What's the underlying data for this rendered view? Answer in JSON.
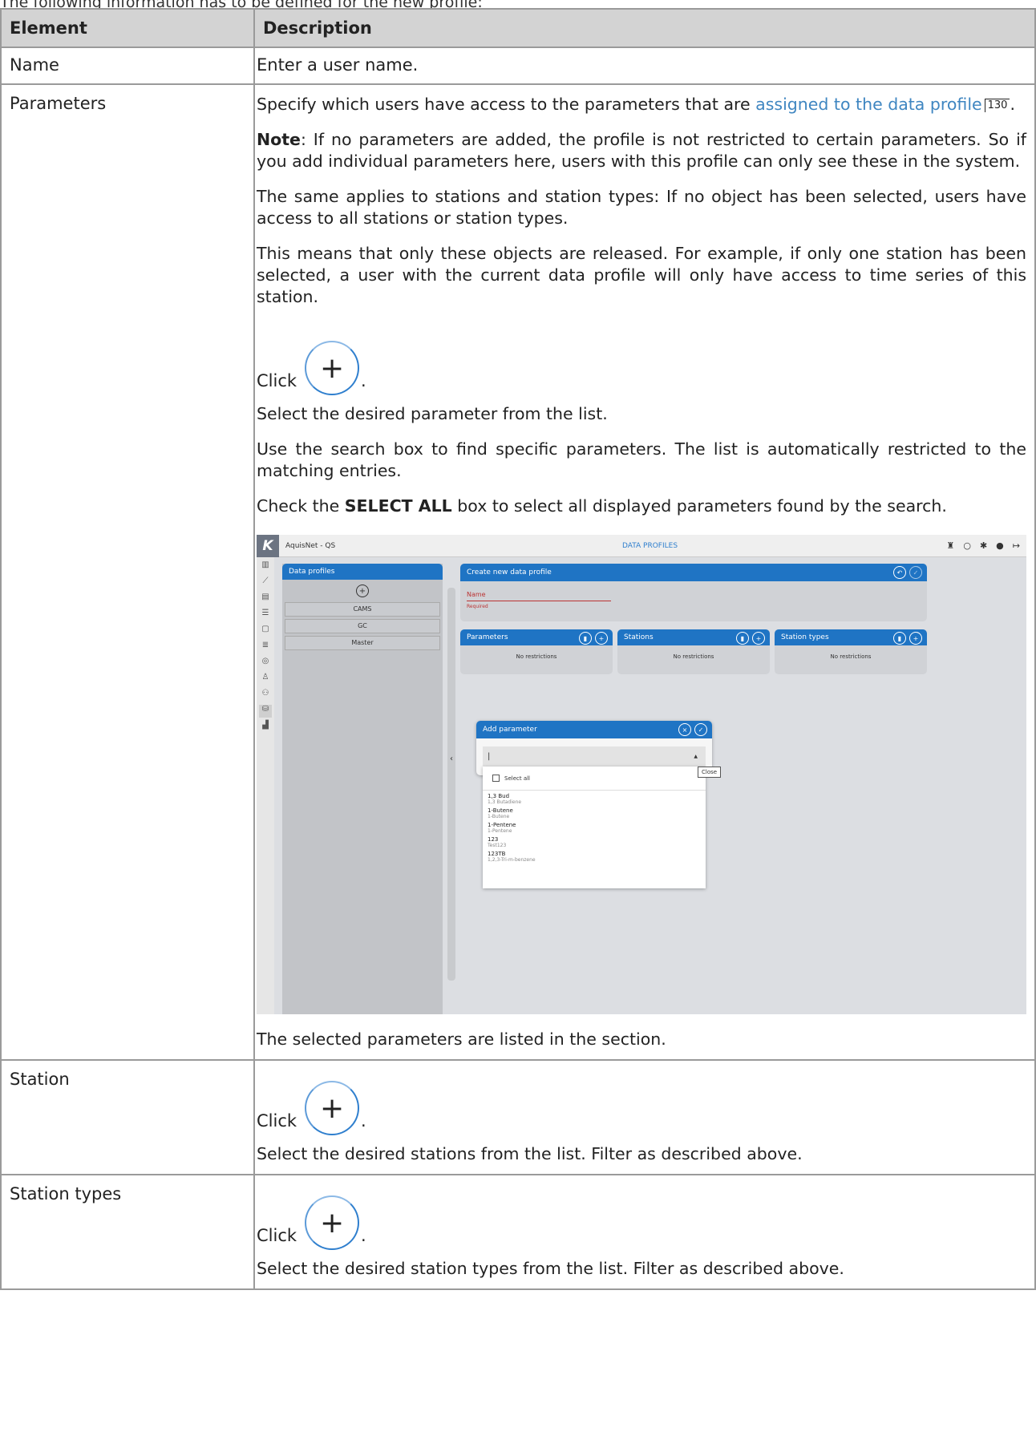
{
  "intro": "The following information has to be defined for the new profile:",
  "table": {
    "headers": [
      "Element",
      "Description"
    ],
    "name_row": {
      "element": "Name",
      "description": "Enter a user name."
    },
    "parameters_row": {
      "element": "Parameters",
      "p1_text": "Specify which users have access to the parameters that are ",
      "p1_link": "assigned to the data profile",
      "p1_ref": "130",
      "p1_end": ".",
      "note_label": "Note",
      "note_text": ": If no parameters are added, the profile is not restricted to certain parameters. So if you add individual parameters here, users with this profile can only see these in the system.",
      "p3": "The same applies to stations and station types: If no object has been selected, users have access to all stations or station types.",
      "p4": "This means that only these objects are released. For example, if only one station has been selected, a user with the current data profile will only have access to time series of this station.",
      "click": "Click",
      "dot": ".",
      "p6": "Select the desired parameter from the list.",
      "p7": "Use the search box to find specific parameters. The list is automatically restricted to the matching entries.",
      "p8_a": "Check the ",
      "p8_bold": "SELECT ALL",
      "p8_b": " box to select all displayed parameters found by the search.",
      "p9": "The selected parameters are listed in the section."
    },
    "station_row": {
      "element": "Station",
      "click": "Click",
      "dot": ".",
      "p": "Select the desired stations from the list. Filter as described above."
    },
    "station_types_row": {
      "element": "Station types",
      "click": "Click",
      "dot": ".",
      "p": "Select the desired station types from the list. Filter as described above."
    }
  },
  "screenshot": {
    "app_title": "AquisNet - QS",
    "page_title": "DATA PROFILES",
    "data_profiles_title": "Data profiles",
    "profiles": [
      "CAMS",
      "GC",
      "Master"
    ],
    "create_title": "Create new data profile",
    "name_label": "Name",
    "required": "Required",
    "cards": [
      {
        "title": "Parameters",
        "body": "No restrictions"
      },
      {
        "title": "Stations",
        "body": "No restrictions"
      },
      {
        "title": "Station types",
        "body": "No restrictions"
      }
    ],
    "modal_title": "Add parameter",
    "tooltip": "Close",
    "select_all": "Select all",
    "options": [
      {
        "name": "1,3 Bud",
        "sub": "1,3 Butadiene"
      },
      {
        "name": "1-Butene",
        "sub": "1-Butene"
      },
      {
        "name": "1-Pentene",
        "sub": "1-Pentene"
      },
      {
        "name": "123",
        "sub": "Test123"
      },
      {
        "name": "123TB",
        "sub": "1,2,3-Tri-m-benzene"
      }
    ]
  }
}
